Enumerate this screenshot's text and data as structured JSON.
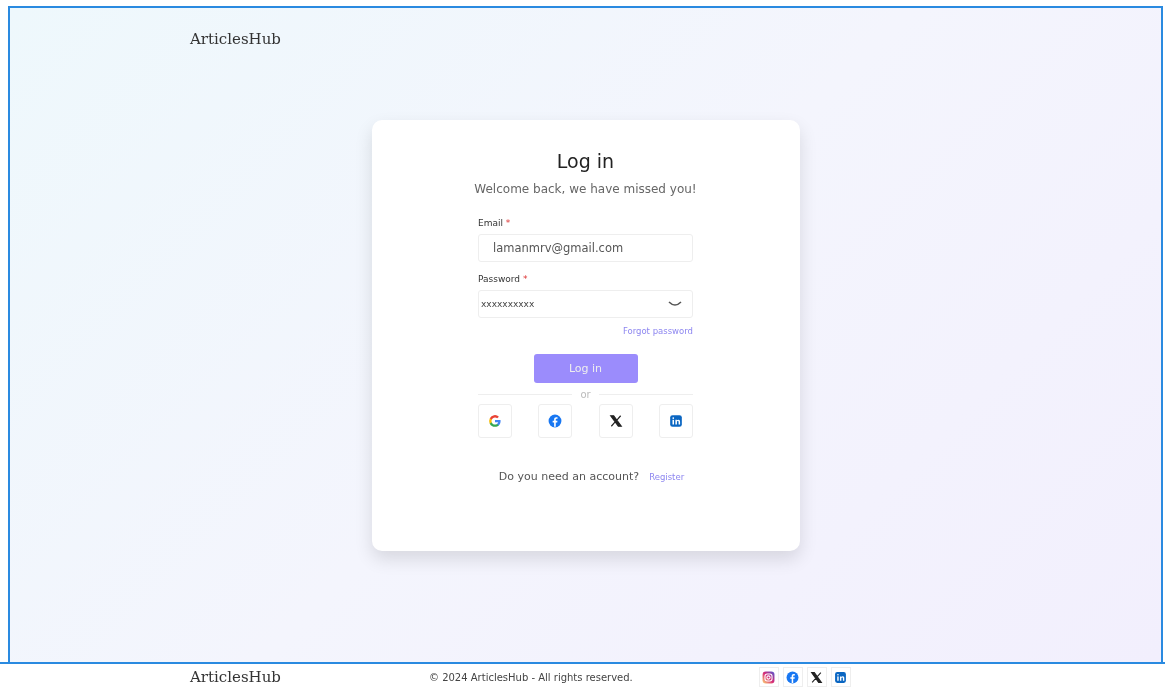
{
  "header": {
    "logo": "ArticlesHub"
  },
  "login": {
    "title": "Log in",
    "subtitle": "Welcome back, we have missed you!",
    "fields": [
      {
        "kind": "text",
        "label": "Email",
        "required_mark": "*",
        "value": "lamanmrv@gmail.com"
      },
      {
        "kind": "password",
        "label": "Password",
        "required_mark": "*",
        "value": "xxxxxxxxxx"
      }
    ],
    "forgot_link": "Forgot password",
    "submit": "Log in",
    "divider": "or",
    "social_buttons": [
      {
        "kind": "google"
      },
      {
        "kind": "facebook"
      },
      {
        "kind": "x"
      },
      {
        "kind": "linkedin"
      }
    ],
    "register_prompt": "Do you need an account?",
    "register_link": "Register"
  },
  "footer": {
    "logo": "ArticlesHub",
    "copyright": "© 2024 ArticlesHub - All rights reserved.",
    "social_icons": [
      {
        "kind": "instagram"
      },
      {
        "kind": "facebook"
      },
      {
        "kind": "x"
      },
      {
        "kind": "linkedin"
      }
    ]
  }
}
